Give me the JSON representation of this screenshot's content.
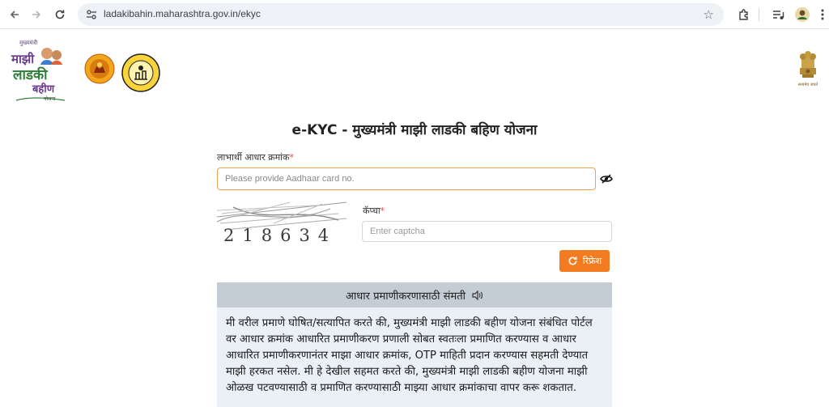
{
  "browser": {
    "url": "ladakibahin.maharashtra.gov.in/ekyc"
  },
  "header": {
    "logo_text_top": "मुख्यमंत्री",
    "logo_text_main_1": "माझी",
    "logo_text_main_2": "लाडकी",
    "logo_text_main_3": "बहीण",
    "logo_text_sub": "योजना",
    "emblem_india_motto": "सत्यमेव जयते"
  },
  "form": {
    "title": "e-KYC - मुख्यमंत्री माझी लाडकी बहिण योजना",
    "aadhaar_label": "लाभार्थी आधार क्रमांक",
    "aadhaar_placeholder": "Please provide Aadhaar card no.",
    "required_mark": "*",
    "captcha_label": "कॅप्चा",
    "captcha_code": "218634",
    "captcha_placeholder": "Enter captcha",
    "refresh_label": "रिफ्रेश"
  },
  "consent": {
    "header": "आधार प्रमाणीकरणासाठी संमती",
    "body": "मी वरील प्रमाणे घोषित/सत्यापित करते की, मुख्यमंत्री माझी लाडकी बहीण योजना संबंधित पोर्टल वर आधार क्रमांक आधारित प्रमाणीकरण प्रणाली सोबत स्वतःला प्रमाणित करण्यास व आधार आधारित प्रमाणीकरणानंतर माझा आधार क्रमांक, OTP माहिती प्रदान करण्यास सहमती देण्यात माझी हरकत नसेल. मी हे देखील सहमत करते की, मुख्यमंत्री माझी लाडकी बहीण योजना माझी ओळख पटवण्यासाठी व प्रमाणित करण्यासाठी माझ्या आधार क्रमांकाचा वापर करू शकतात."
  },
  "colors": {
    "accent": "#f47c20",
    "consent_header_bg": "#c4ccd6",
    "consent_body_bg": "#eaf0f6",
    "logo_purple": "#6a3a8c",
    "logo_green": "#2f7d3a"
  },
  "icons": [
    "back-icon",
    "forward-icon",
    "reload-icon",
    "site-settings-icon",
    "bookmark-star-icon",
    "extensions-icon",
    "media-controls-icon",
    "profile-avatar",
    "eye-off-icon",
    "refresh-icon",
    "speaker-icon"
  ]
}
